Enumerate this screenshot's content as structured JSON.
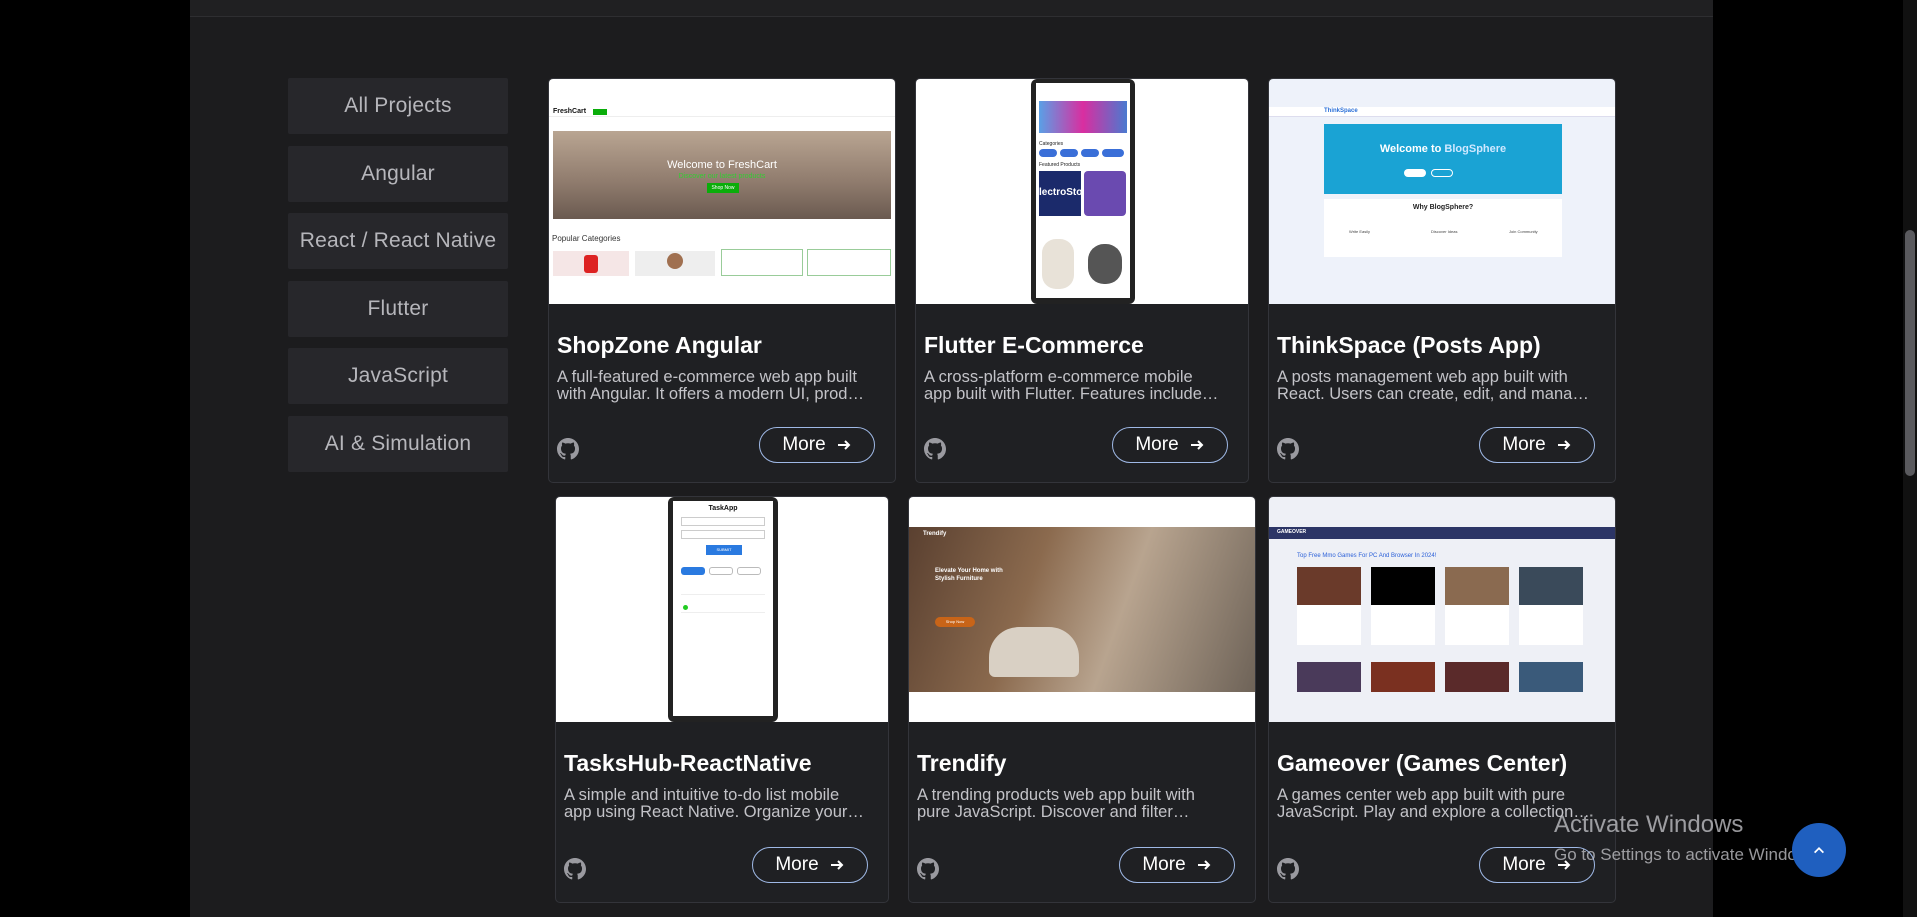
{
  "sidebar": {
    "items": [
      {
        "label": "All Projects"
      },
      {
        "label": "Angular"
      },
      {
        "label": "React / React Native"
      },
      {
        "label": "Flutter"
      },
      {
        "label": "JavaScript"
      },
      {
        "label": "AI & Simulation"
      }
    ]
  },
  "projects": [
    {
      "title": "ShopZone Angular",
      "description": "A full-featured e-commerce web app built with Angular. It offers a modern UI, product listings, categories and a shopping cart.",
      "more": "More"
    },
    {
      "title": "Flutter E-Commerce",
      "description": "A cross-platform e-commerce mobile app built with Flutter. Features include product browsing, categories and cart.",
      "more": "More"
    },
    {
      "title": "ThinkSpace (Posts App)",
      "description": "A posts management web app built with React. Users can create, edit, and manage posts.",
      "more": "More"
    },
    {
      "title": "TasksHub-ReactNative",
      "description": "A simple and intuitive to-do list mobile app using React Native. Organize your daily tasks with ease.",
      "more": "More"
    },
    {
      "title": "Trendify",
      "description": "A trending products web app built with pure JavaScript. Discover and filter popular products.",
      "more": "More"
    },
    {
      "title": "Gameover (Games Center)",
      "description": "A games center web app built with pure JavaScript. Play and explore a collection of free games.",
      "more": "More"
    }
  ],
  "thumbs": {
    "freshcart": {
      "brand": "FreshCart",
      "hero": "Welcome to FreshCart",
      "sub": "Discover our latest products",
      "cta": "Shop Now",
      "section": "Popular Categories"
    },
    "flutter": {
      "cat": "Categories",
      "feat": "Featured Products",
      "banner": "lectroStore"
    },
    "blog": {
      "brand": "ThinkSpace",
      "hero_prefix": "Welcome to ",
      "hero_name": "BlogSphere",
      "why": "Why BlogSphere?",
      "f1": "Write Easily",
      "f2": "Discover Ideas",
      "f3": "Join Community"
    },
    "tasks": {
      "title": "TaskApp",
      "submit": "SUBMIT"
    },
    "trendify": {
      "brand": "Trendify",
      "headline": "Elevate Your Home with Stylish Furniture",
      "cta": "Shop Now"
    },
    "games": {
      "brand": "GAMEOVER",
      "headline": "Top Free Mmo Games For PC And Browser In 2024!"
    }
  },
  "overlay": {
    "activate_title": "Activate Windows",
    "activate_sub": "Go to Settings to activate Windows."
  },
  "colors": {
    "background": "#000000",
    "panel": "#1c1c1e",
    "card": "#1f2023",
    "sidebar_button": "#27272b",
    "accent_border": "#9fb9e6",
    "scroll_top": "#1f5fbf"
  },
  "icons": {
    "repo": "github-icon",
    "more": "arrow-right-icon",
    "scroll_top": "chevron-up-icon"
  }
}
